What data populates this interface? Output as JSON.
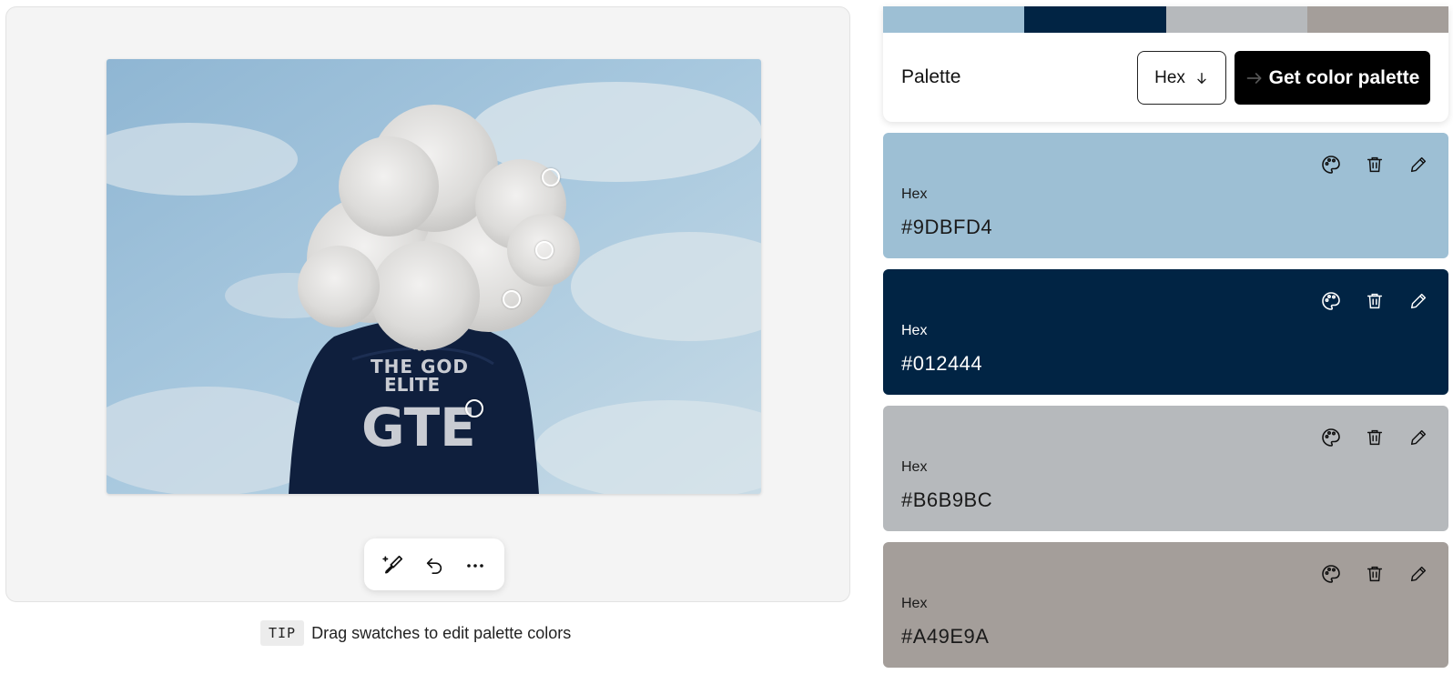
{
  "image_panel": {
    "markers": [
      {
        "name": "marker-1",
        "color": "#9DBFD4"
      },
      {
        "name": "marker-2",
        "color": "#B6B9BC"
      },
      {
        "name": "marker-3",
        "color": "#A49E9A"
      },
      {
        "name": "marker-4",
        "color": "#012444"
      }
    ],
    "toolbar": {
      "eyedropper_icon": "eyedropper-add-icon",
      "undo_icon": "undo-icon",
      "more_icon": "more-icon"
    },
    "tip": {
      "badge": "TIP",
      "text": "Drag swatches to edit palette colors"
    }
  },
  "palette": {
    "strip_colors": [
      "#9DBFD4",
      "#012444",
      "#B6B9BC",
      "#A49E9A"
    ],
    "title": "Palette",
    "format_select": {
      "value": "Hex",
      "icon": "arrow-down-icon"
    },
    "get_button": {
      "label": "Get color palette",
      "icon": "arrow-right-icon"
    },
    "swatches": [
      {
        "label": "Hex",
        "value": "#9DBFD4",
        "color": "#9DBFD4",
        "text_color": "dark"
      },
      {
        "label": "Hex",
        "value": "#012444",
        "color": "#012444",
        "text_color": "light"
      },
      {
        "label": "Hex",
        "value": "#B6B9BC",
        "color": "#B6B9BC",
        "text_color": "dark"
      },
      {
        "label": "Hex",
        "value": "#A49E9A",
        "color": "#A49E9A",
        "text_color": "dark"
      }
    ],
    "swatch_actions": [
      "palette-icon",
      "trash-icon",
      "pencil-icon"
    ]
  }
}
